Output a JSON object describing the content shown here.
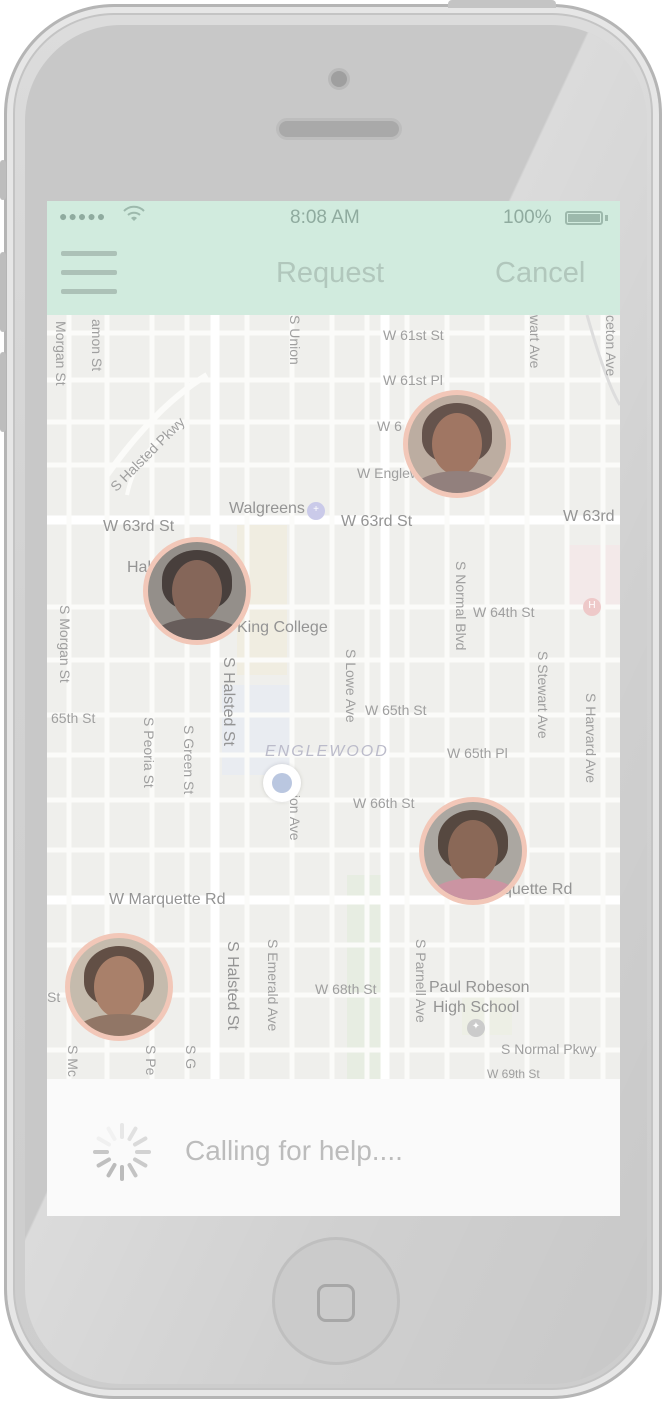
{
  "statusbar": {
    "signal": "●●●●●",
    "wifi_icon": "wifi-icon",
    "time": "8:08 AM",
    "battery": "100%"
  },
  "navbar": {
    "title": "Request",
    "cancel_label": "Cancel"
  },
  "map": {
    "labels": {
      "w61st": "W 61st St",
      "w61stpl": "W 61st Pl",
      "w6": "W 6",
      "wenglew": "W Englew",
      "halsted_pkwy": "S Halsted Pkwy",
      "walgreens": "Walgreens",
      "w63rd_left": "W 63rd St",
      "w63rd_mid": "W 63rd St",
      "w63rd_right": "W 63rd",
      "hal": "Hal",
      "king_college": "King College",
      "w64th": "W 64th St",
      "morgan1": "Morgan St",
      "morgan2": "S Morgan St",
      "damon": "amon St",
      "union": "S Union",
      "sstewart_top": "wart Ave",
      "princeton": "ceton Ave",
      "normal_blvd": "S Normal Blvd",
      "halsted_st": "S Halsted St",
      "lowe": "S Lowe Ave",
      "w65th_mid": "W 65th St",
      "w65th_left": "65th St",
      "w65thpl": "W 65th Pl",
      "stewart": "S Stewart Ave",
      "harvard": "S Harvard Ave",
      "peoria": "S Peoria St",
      "green": "S Green St",
      "englewood": "ENGLEWOOD",
      "union2": "Union Ave",
      "w66th": "W 66th St",
      "marquette_left": "W Marquette Rd",
      "marquette_right": "quette Rd",
      "halsted_st2": "S Halsted St",
      "emerald": "S Emerald Ave",
      "w68th": "W 68th St",
      "parnell": "S Parnell Ave",
      "paul_robeson": "Paul Robeson",
      "high_school": "High School",
      "normal_pkwy": "S Normal Pkwy",
      "w69th": "W 69th St",
      "st_left": "St",
      "smc": "S Mc",
      "spe": "S Pe",
      "sg": "S G"
    },
    "helpers": [
      {
        "name": "helper-1"
      },
      {
        "name": "helper-2"
      },
      {
        "name": "helper-3"
      },
      {
        "name": "helper-4"
      }
    ]
  },
  "calling": {
    "text": "Calling for help...."
  },
  "colors": {
    "header_bg": "#cfeadd",
    "header_text": "#adc4b9",
    "avatar_ring": "#f2c5b5",
    "user_dot": "#b7c4df"
  }
}
